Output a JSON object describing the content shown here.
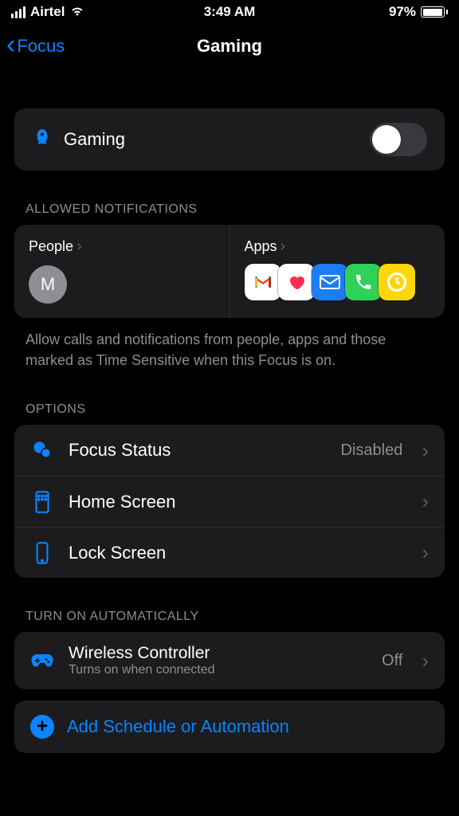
{
  "statusbar": {
    "carrier": "Airtel",
    "time": "3:49 AM",
    "battery_pct": "97%"
  },
  "nav": {
    "back_label": "Focus",
    "title": "Gaming"
  },
  "focus_toggle": {
    "label": "Gaming",
    "on": false
  },
  "allowed": {
    "header": "Allowed Notifications",
    "people_label": "People",
    "people_initial": "M",
    "apps_label": "Apps",
    "footer": "Allow calls and notifications from people, apps and those marked as Time Sensitive when this Focus is on."
  },
  "options": {
    "header": "Options",
    "items": [
      {
        "label": "Focus Status",
        "value": "Disabled"
      },
      {
        "label": "Home Screen",
        "value": ""
      },
      {
        "label": "Lock Screen",
        "value": ""
      }
    ]
  },
  "auto": {
    "header": "Turn On Automatically",
    "item": {
      "label": "Wireless Controller",
      "sub": "Turns on when connected",
      "value": "Off"
    },
    "add_label": "Add Schedule or Automation"
  }
}
